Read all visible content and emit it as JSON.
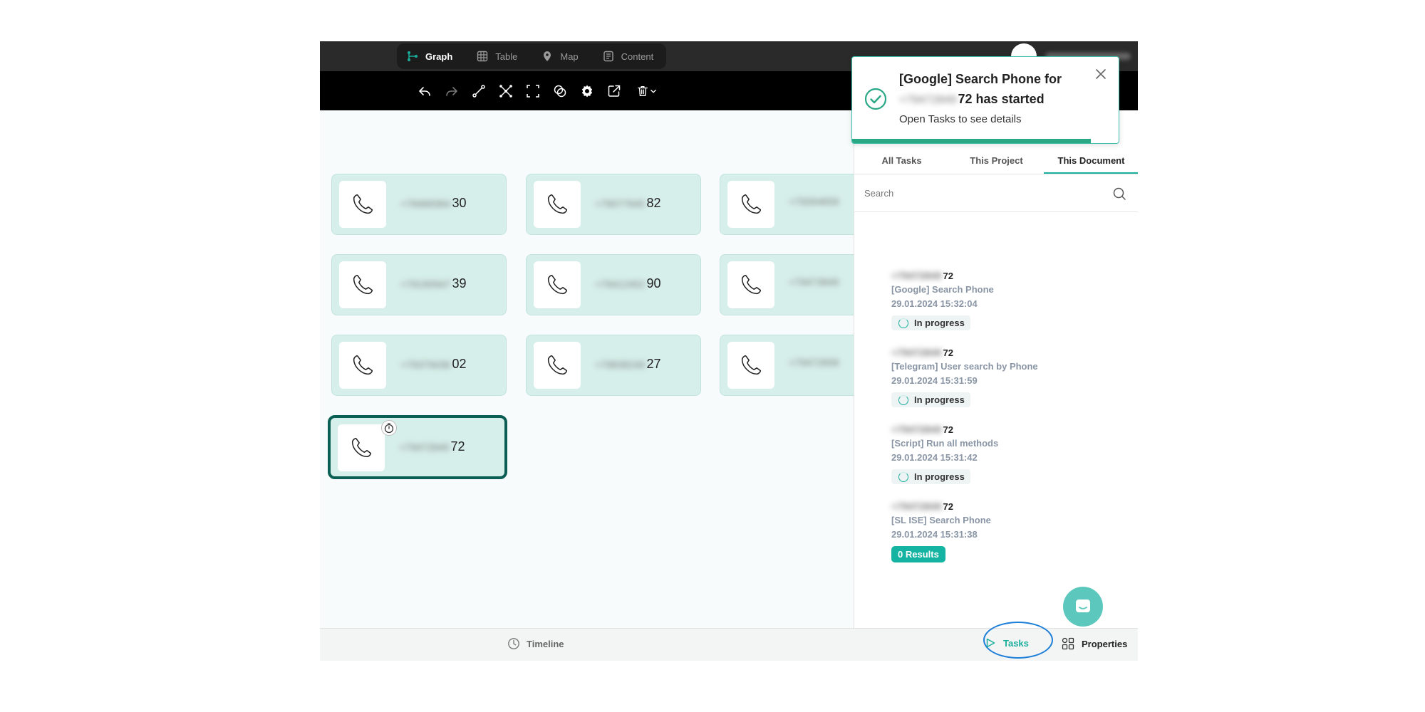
{
  "topbar": {
    "view_tabs": [
      {
        "label": "Graph",
        "icon": "graph-icon",
        "active": true
      },
      {
        "label": "Table",
        "icon": "table-icon",
        "active": false
      },
      {
        "label": "Map",
        "icon": "map-pin-icon",
        "active": false
      },
      {
        "label": "Content",
        "icon": "content-icon",
        "active": false
      }
    ]
  },
  "toolbar": {
    "tools": [
      "undo-icon",
      "redo-icon",
      "connect-icon",
      "layout-icon",
      "select-area-icon",
      "merge-icon",
      "settings-icon",
      "share-icon",
      "delete-icon",
      "chevron-down-icon"
    ]
  },
  "nodes": [
    {
      "masked": "+78468364",
      "suffix": "30"
    },
    {
      "masked": "+79077645",
      "suffix": "82"
    },
    {
      "masked": "+79264659",
      "suffix": ""
    },
    {
      "masked": "+79190947",
      "suffix": "39"
    },
    {
      "masked": "+79412452",
      "suffix": "90"
    },
    {
      "masked": "+79473849",
      "suffix": ""
    },
    {
      "masked": "+79379436",
      "suffix": "02"
    },
    {
      "masked": "+79838248",
      "suffix": "27"
    },
    {
      "masked": "+79472658",
      "suffix": ""
    },
    {
      "masked": "+79472849",
      "suffix": "72"
    }
  ],
  "toast": {
    "title_prefix": "[Google] Search Phone for",
    "title_masked": "+79472849",
    "title_suffix": "72 has started",
    "subtitle": "Open Tasks to see details",
    "accent": "#3dbfae"
  },
  "panel": {
    "tabs": [
      {
        "label": "All Tasks",
        "active": false
      },
      {
        "label": "This Project",
        "active": false
      },
      {
        "label": "This Document",
        "active": true
      }
    ],
    "search_placeholder": "Search",
    "tasks": [
      {
        "target_masked": "+79472849",
        "target_suffix": "72",
        "name": "[Google] Search Phone",
        "time": "29.01.2024 15:32:04",
        "status": "In progress"
      },
      {
        "target_masked": "+79472849",
        "target_suffix": "72",
        "name": "[Telegram] User search by Phone",
        "time": "29.01.2024 15:31:59",
        "status": "In progress"
      },
      {
        "target_masked": "+79472849",
        "target_suffix": "72",
        "name": "[Script] Run all methods",
        "time": "29.01.2024 15:31:42",
        "status": "In progress"
      },
      {
        "target_masked": "+79472849",
        "target_suffix": "72",
        "name": "[SL ISE] Search Phone",
        "time": "29.01.2024 15:31:38",
        "status": "0 Results"
      }
    ]
  },
  "bottombar": {
    "timeline_label": "Timeline",
    "tasks_label": "Tasks",
    "properties_label": "Properties"
  },
  "colors": {
    "accent": "#1aaf9c",
    "node_fill": "#d7efea",
    "selected_border": "#0b5e54",
    "highlight_ring": "#1e7fd8"
  }
}
